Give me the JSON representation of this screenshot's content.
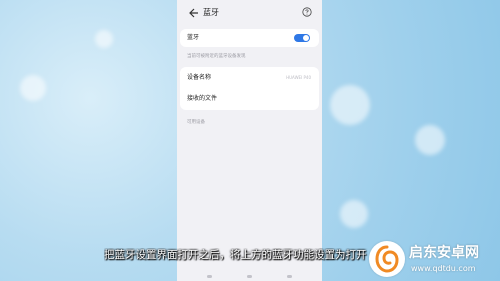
{
  "header": {
    "title": "蓝牙"
  },
  "bluetooth": {
    "label": "蓝牙",
    "enabled": true,
    "hint": "当前可被附近的蓝牙设备发现"
  },
  "settings": {
    "device_name_label": "设备名称",
    "device_name_value": "HUAWEI P40",
    "received_files_label": "接收的文件"
  },
  "available_devices": {
    "section_label": "可用设备"
  },
  "caption": "把蓝牙设置界面打开之后，将上方的蓝牙功能设置为打开",
  "watermark": {
    "name": "启东安卓网",
    "url": "www.qdtdu.com"
  },
  "colors": {
    "accent": "#2f78e6",
    "background": "#f1f1f5"
  }
}
